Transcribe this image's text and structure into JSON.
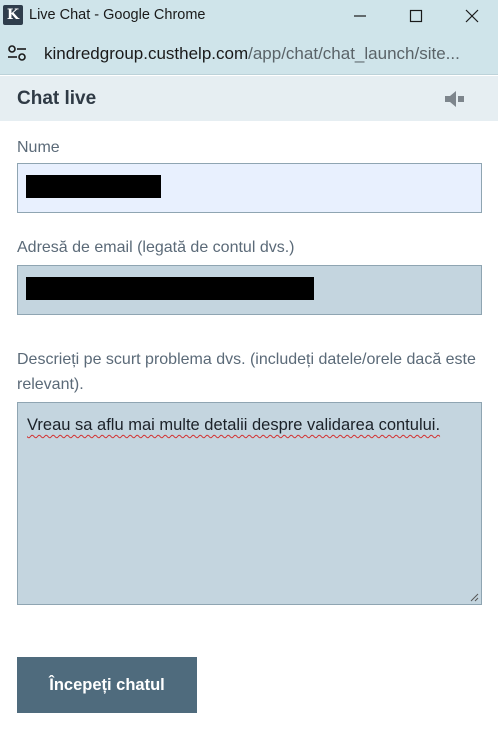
{
  "window": {
    "app_icon_letter": "K",
    "title": "Live Chat - Google Chrome"
  },
  "address_bar": {
    "host": "kindredgroup.custhelp.com",
    "path": "/app/chat/chat_launch/site..."
  },
  "chat": {
    "header_title": "Chat live",
    "icons": {
      "sound": "speaker-icon",
      "site_settings": "tune-icon"
    }
  },
  "form": {
    "name_label": "Nume",
    "name_value": "",
    "email_label": "Adresă de email (legată de contul dvs.)",
    "email_value": "",
    "description_label": "Descrieți pe scurt problema dvs. (includeți datele/orele dacă este relevant).",
    "description_value": "Vreau sa aflu mai multe detalii despre validarea contului.",
    "submit_label": "Începeți chatul"
  },
  "colors": {
    "chrome_frame": "#cfe4ea",
    "header_bg": "#e6eef2",
    "field_bg": "#c4d5df",
    "autofill_bg": "#e8f0fe",
    "button_bg": "#4f6b7d"
  }
}
